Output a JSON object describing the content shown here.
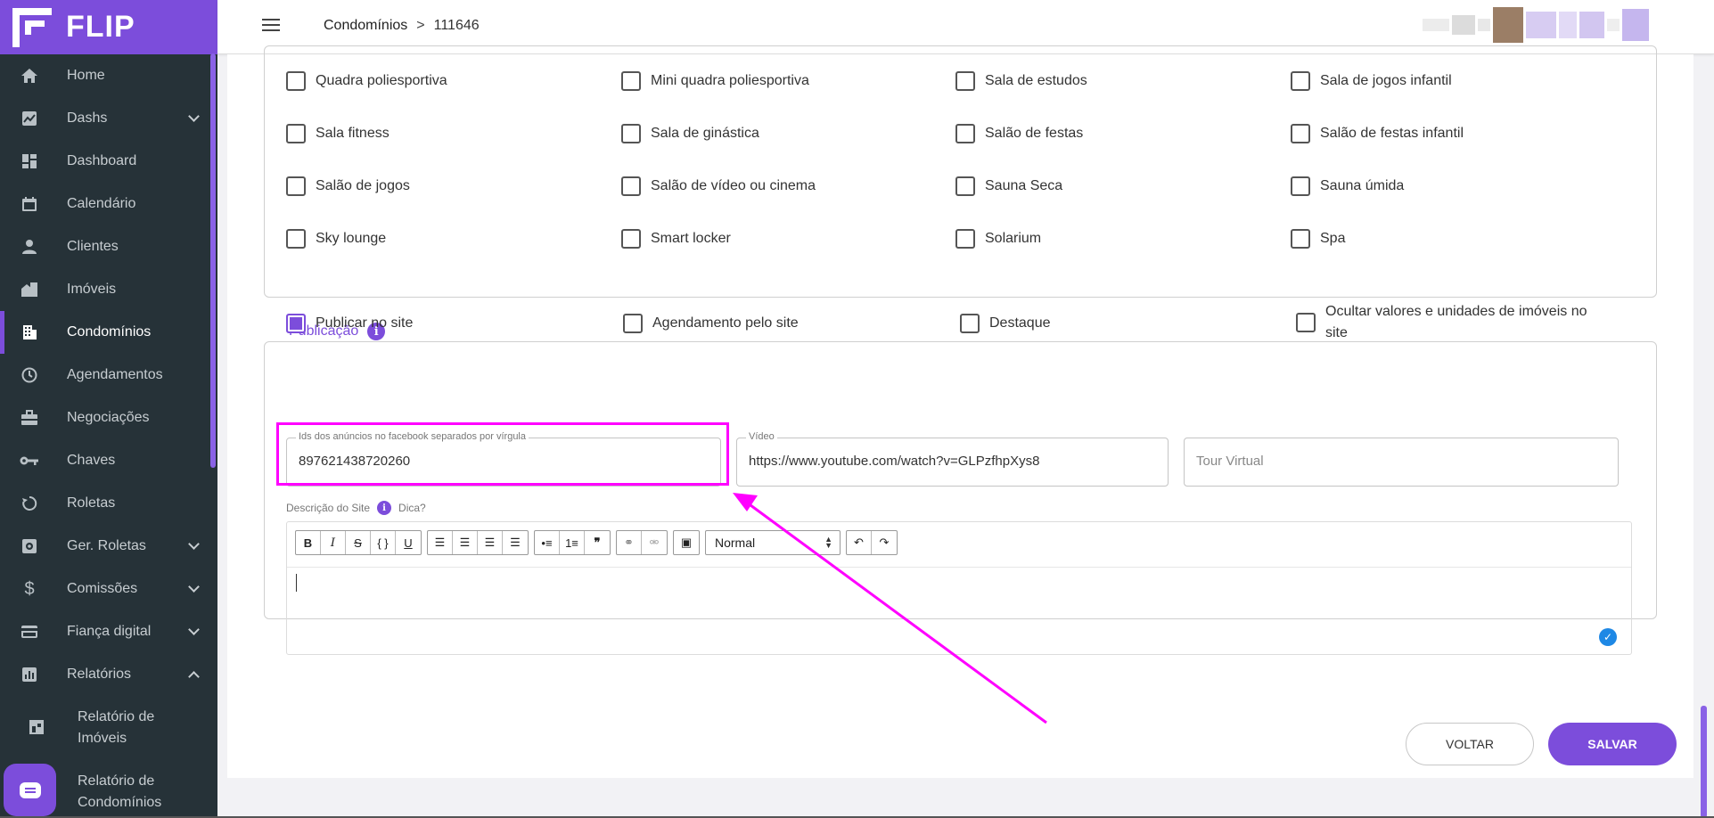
{
  "brand": {
    "name": "FLIP",
    "color": "#7c4ddb"
  },
  "sidebar": {
    "items": [
      {
        "label": "Home",
        "icon": "home-icon"
      },
      {
        "label": "Dashs",
        "icon": "chart-icon",
        "expandable": true
      },
      {
        "label": "Dashboard",
        "icon": "dashboard-icon"
      },
      {
        "label": "Calendário",
        "icon": "calendar-icon"
      },
      {
        "label": "Clientes",
        "icon": "person-icon"
      },
      {
        "label": "Imóveis",
        "icon": "building-icon"
      },
      {
        "label": "Condomínios",
        "icon": "apartment-icon",
        "active": true
      },
      {
        "label": "Agendamentos",
        "icon": "clock-icon"
      },
      {
        "label": "Negociações",
        "icon": "briefcase-icon"
      },
      {
        "label": "Chaves",
        "icon": "key-icon"
      },
      {
        "label": "Roletas",
        "icon": "refresh-icon"
      },
      {
        "label": "Ger. Roletas",
        "icon": "settings-box-icon",
        "expandable": true
      },
      {
        "label": "Comissões",
        "icon": "dollar-icon",
        "expandable": true
      },
      {
        "label": "Fiança digital",
        "icon": "credit-card-icon",
        "expandable": true
      },
      {
        "label": "Relatórios",
        "icon": "report-icon",
        "expandable": true,
        "expanded": true
      }
    ],
    "sub_items": [
      {
        "line1": "Relatório de",
        "line2": "Imóveis"
      },
      {
        "line1": "Relatório de",
        "line2": "Condomínios"
      }
    ]
  },
  "header": {
    "breadcrumb": {
      "section": "Condomínios",
      "separator": ">",
      "current": "111646"
    }
  },
  "amenities": [
    "Quadra poliesportiva",
    "Mini quadra poliesportiva",
    "Sala de estudos",
    "Sala de jogos infantil",
    "Sala fitness",
    "Sala de ginástica",
    "Salão de festas",
    "Salão de festas infantil",
    "Salão de jogos",
    "Salão de vídeo ou cinema",
    "Sauna Seca",
    "Sauna úmida",
    "Sky lounge",
    "Smart locker",
    "Solarium",
    "Spa"
  ],
  "publicacao": {
    "title": "Publicação",
    "options": [
      {
        "label": "Publicar no site",
        "checked": true
      },
      {
        "label": "Agendamento pelo site",
        "checked": false
      },
      {
        "label": "Destaque",
        "checked": false
      },
      {
        "label": "Ocultar valores e unidades de imóveis no site",
        "checked": false
      }
    ],
    "facebook_ids": {
      "label": "Ids dos anúncios no facebook separados por vírgula",
      "value": "897621438720260"
    },
    "video": {
      "label": "Vídeo",
      "value": "https://www.youtube.com/watch?v=GLPzfhpXys8"
    },
    "tour_virtual": {
      "placeholder": "Tour Virtual"
    },
    "descricao": {
      "label": "Descrição do Site",
      "tip": "Dica?",
      "format": "Normal"
    }
  },
  "actions": {
    "back": "VOLTAR",
    "save": "SALVAR"
  },
  "annotation": {
    "color": "#ff00ff"
  }
}
